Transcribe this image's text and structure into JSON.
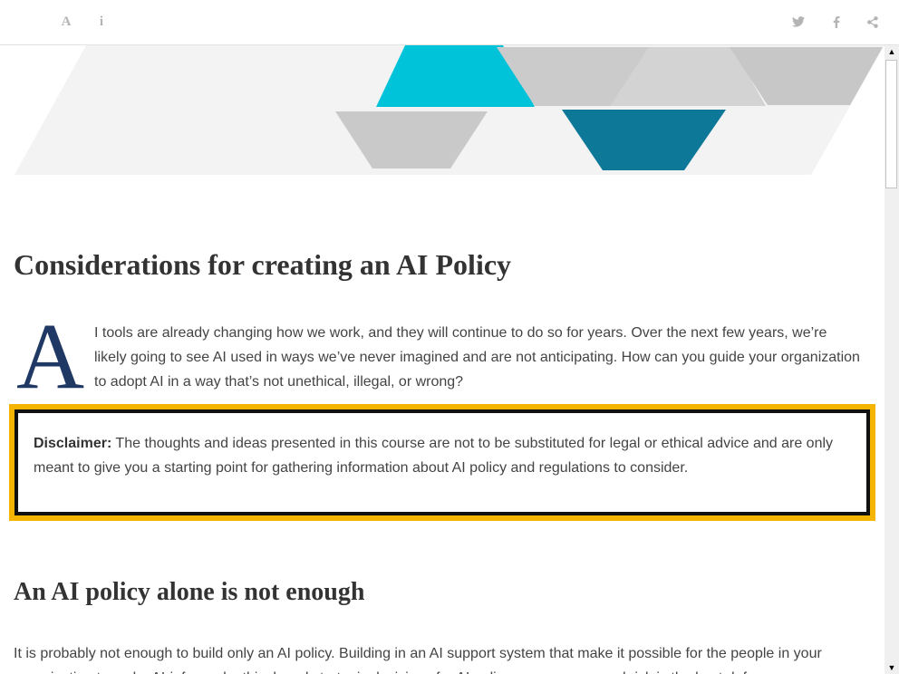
{
  "toolbar": {
    "left_icons": [
      "font-size-icon",
      "info-icon"
    ],
    "font_glyph": "A",
    "info_glyph": "i",
    "right_icons": [
      "twitter-icon",
      "facebook-icon",
      "share-icon"
    ]
  },
  "content": {
    "title": "Considerations for creating an AI Policy",
    "drop_cap": "A",
    "intro": "I tools are already changing how we work, and they will continue to do so for years. Over the next few years, we’re likely going to see AI used in ways we’ve never imagined and are not anticipating. How can you guide your organization to adopt AI in a way that’s not unethical, illegal, or wrong?",
    "disclaimer_label": "Disclaimer:",
    "disclaimer_text": " The thoughts and ideas presented in this course are not to be substituted for legal or ethical advice and are only meant to give you a starting point for gathering information about AI policy and regulations to consider.",
    "subheading": "An AI policy alone is not enough",
    "body": "It is probably not enough to build only an AI policy. Building in an AI support system that make it possible for the people in your organization to make AI-informed, ethical, and strategic decisions for AI policy, governance, and risk is the best defense."
  },
  "colors": {
    "accent_cyan": "#00c3d9",
    "accent_teal": "#0e7898",
    "shape_grey": "#c9c9c9",
    "shape_light": "#f3f3f3",
    "drop_cap": "#1f3864",
    "disclaimer_border": "#f5b400"
  },
  "scrollbar": {
    "up_glyph": "▲",
    "down_glyph": "▼"
  }
}
